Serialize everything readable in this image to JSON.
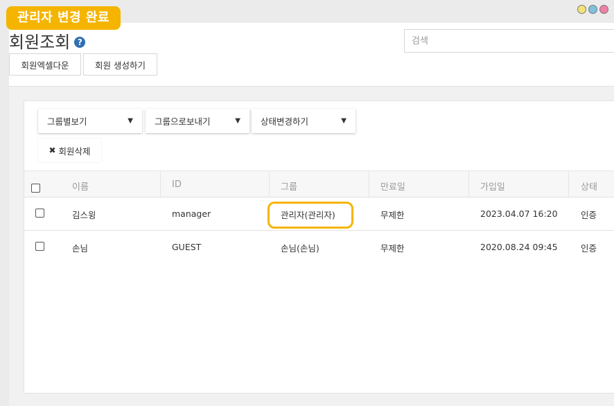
{
  "badge": {
    "text": "관리자 변경 완료",
    "color": "#f5b400"
  },
  "window_dots": [
    {
      "name": "yellow-dot",
      "color": "#f2e27a"
    },
    {
      "name": "blue-dot",
      "color": "#7fc1df"
    },
    {
      "name": "pink-dot",
      "color": "#ee7fa6"
    }
  ],
  "header": {
    "title": "회원조회",
    "help_icon": "question-circle-icon",
    "search_placeholder": "검색"
  },
  "toolbar": {
    "export_label": "회원엑셀다운",
    "create_label": "회원 생성하기"
  },
  "filters": {
    "group_view": "그룹별보기",
    "group_move": "그룹으로보내기",
    "status_change": "상태변경하기",
    "delete_label": "회원삭제"
  },
  "table": {
    "columns": [
      "이름",
      "ID",
      "그룹",
      "만료일",
      "가입일",
      "상태"
    ],
    "rows": [
      {
        "name": "김스윙",
        "id": "manager",
        "group": "관리자(관리자)",
        "expiry": "무제한",
        "joined": "2023.04.07 16:20",
        "status": "인증"
      },
      {
        "name": "손님",
        "id": "GUEST",
        "group": "손님(손님)",
        "expiry": "무제한",
        "joined": "2020.08.24 09:45",
        "status": "인증"
      }
    ]
  },
  "colors": {
    "highlight": "#f5b400",
    "help_icon": "#2e6fb5"
  }
}
